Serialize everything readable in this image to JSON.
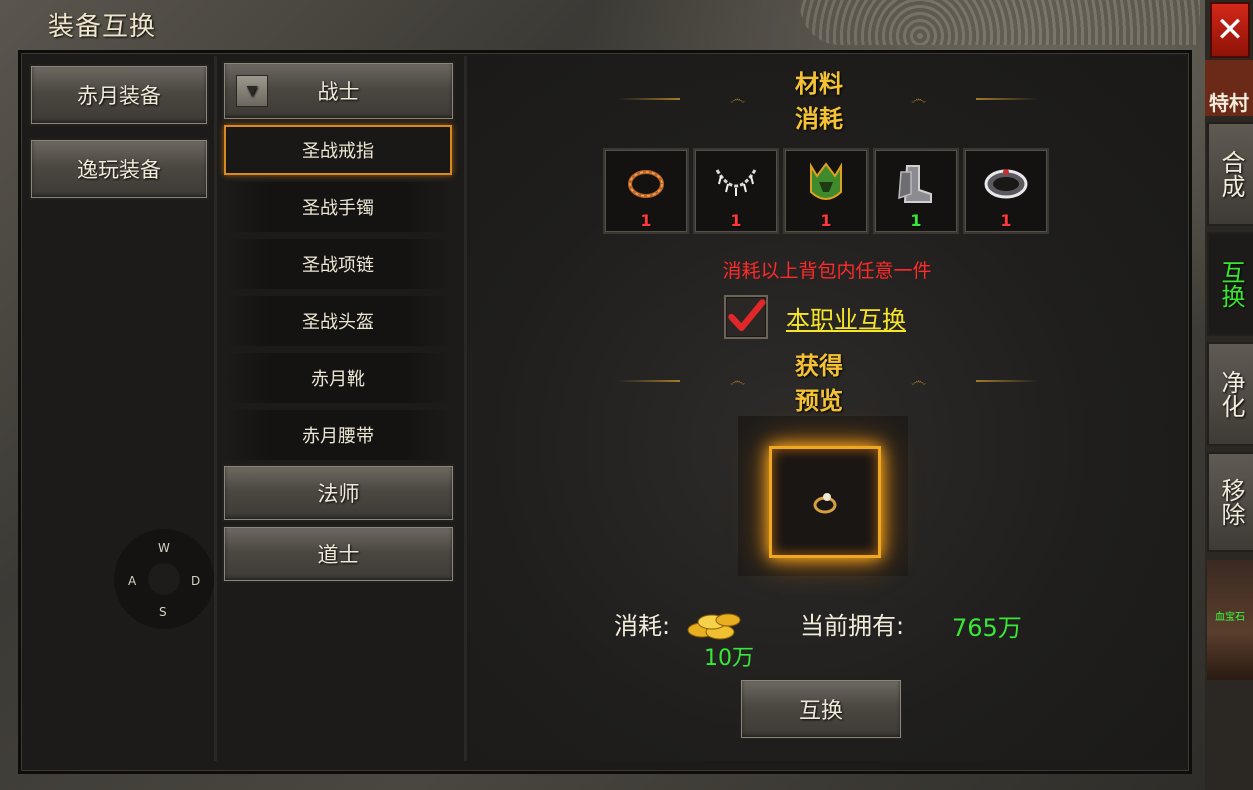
{
  "window": {
    "title": "装备互换",
    "close_label": "✕"
  },
  "categories": [
    {
      "label": "赤月装备"
    },
    {
      "label": "逸玩装备"
    }
  ],
  "classes": [
    {
      "label": "战士",
      "expanded": true
    },
    {
      "label": "法师"
    },
    {
      "label": "道士"
    }
  ],
  "warrior_items": [
    {
      "label": "圣战戒指",
      "active": true
    },
    {
      "label": "圣战手镯"
    },
    {
      "label": "圣战项链"
    },
    {
      "label": "圣战头盔"
    },
    {
      "label": "赤月靴"
    },
    {
      "label": "赤月腰带"
    }
  ],
  "compass": {
    "n": "W",
    "w": "A",
    "e": "D",
    "s": "S"
  },
  "materials": {
    "header": "材料消耗",
    "slots": [
      {
        "icon": "bracelet-icon",
        "qty": "1",
        "qty_color": "#ff3838"
      },
      {
        "icon": "necklace-icon",
        "qty": "1",
        "qty_color": "#ff3838"
      },
      {
        "icon": "helmet-icon",
        "qty": "1",
        "qty_color": "#ff3838"
      },
      {
        "icon": "boots-icon",
        "qty": "1",
        "qty_color": "#38e838"
      },
      {
        "icon": "belt-icon",
        "qty": "1",
        "qty_color": "#ff3838"
      }
    ],
    "warning": "消耗以上背包内任意一件",
    "same_class_label": "本职业互换",
    "same_class_checked": true
  },
  "preview": {
    "header": "获得预览",
    "icon": "ring-icon"
  },
  "cost": {
    "label": "消耗:",
    "coin_icon": "gold-coins-icon",
    "amount": "10万",
    "owned_label": "当前拥有:",
    "owned_amount": "765万"
  },
  "exchange_button": "互换",
  "side_tabs": [
    {
      "label": "特村"
    },
    {
      "label": "合成"
    },
    {
      "label": "互换",
      "active": true
    },
    {
      "label": "净化"
    },
    {
      "label": "移除"
    }
  ],
  "figure_label": "血宝石"
}
